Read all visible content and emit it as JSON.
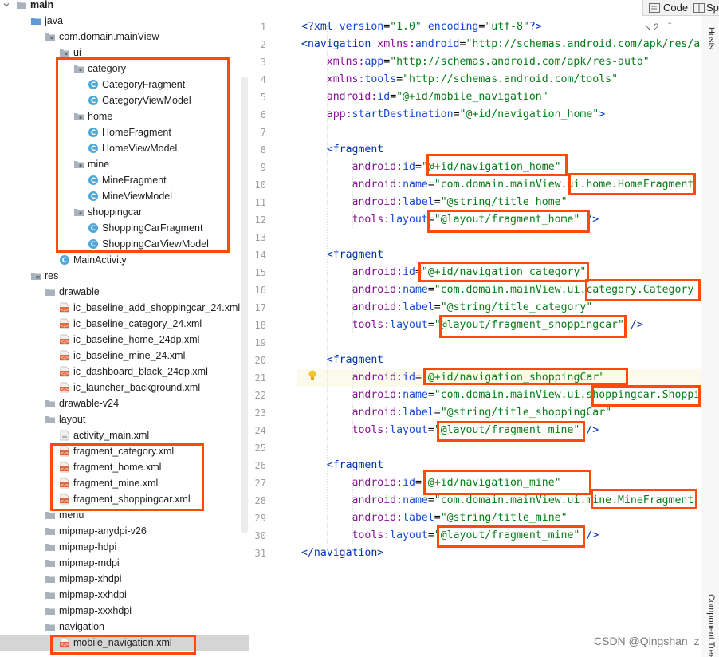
{
  "project_tree": {
    "rows": [
      {
        "label": "main",
        "icon": "folder-icon",
        "expanded": true,
        "bold": true
      },
      {
        "label": "java",
        "icon": "source-folder-icon",
        "expanded": true
      },
      {
        "label": "com.domain.mainView",
        "icon": "package-icon",
        "expanded": true
      },
      {
        "label": "ui",
        "icon": "package-icon",
        "expanded": true
      },
      {
        "label": "category",
        "icon": "package-icon",
        "expanded": true
      },
      {
        "label": "CategoryFragment",
        "icon": "kotlin-class-icon"
      },
      {
        "label": "CategoryViewModel",
        "icon": "kotlin-class-icon"
      },
      {
        "label": "home",
        "icon": "package-icon",
        "expanded": true
      },
      {
        "label": "HomeFragment",
        "icon": "kotlin-class-icon"
      },
      {
        "label": "HomeViewModel",
        "icon": "kotlin-class-icon"
      },
      {
        "label": "mine",
        "icon": "package-icon",
        "expanded": true
      },
      {
        "label": "MineFragment",
        "icon": "kotlin-class-icon"
      },
      {
        "label": "MineViewModel",
        "icon": "kotlin-class-icon"
      },
      {
        "label": "shoppingcar",
        "icon": "package-icon",
        "expanded": true
      },
      {
        "label": "ShoppingCarFragment",
        "icon": "kotlin-class-icon"
      },
      {
        "label": "ShoppingCarViewModel",
        "icon": "kotlin-class-icon"
      },
      {
        "label": "MainActivity",
        "icon": "kotlin-class-icon"
      },
      {
        "label": "res",
        "icon": "resource-folder-icon",
        "expanded": true
      },
      {
        "label": "drawable",
        "icon": "folder-icon",
        "expanded": true
      },
      {
        "label": "ic_baseline_add_shoppingcar_24.xml",
        "icon": "xml-file-icon"
      },
      {
        "label": "ic_baseline_category_24.xml",
        "icon": "xml-file-icon"
      },
      {
        "label": "ic_baseline_home_24dp.xml",
        "icon": "xml-file-icon"
      },
      {
        "label": "ic_baseline_mine_24.xml",
        "icon": "xml-file-icon"
      },
      {
        "label": "ic_dashboard_black_24dp.xml",
        "icon": "xml-file-icon"
      },
      {
        "label": "ic_launcher_background.xml",
        "icon": "xml-file-icon"
      },
      {
        "label": "drawable-v24",
        "icon": "folder-icon",
        "expanded": false
      },
      {
        "label": "layout",
        "icon": "folder-icon",
        "expanded": true
      },
      {
        "label": "activity_main.xml",
        "icon": "layout-file-icon"
      },
      {
        "label": "fragment_category.xml",
        "icon": "xml-file-icon"
      },
      {
        "label": "fragment_home.xml",
        "icon": "xml-file-icon"
      },
      {
        "label": "fragment_mine.xml",
        "icon": "xml-file-icon"
      },
      {
        "label": "fragment_shoppingcar.xml",
        "icon": "xml-file-icon"
      },
      {
        "label": "menu",
        "icon": "folder-icon",
        "expanded": false
      },
      {
        "label": "mipmap-anydpi-v26",
        "icon": "folder-icon",
        "expanded": false
      },
      {
        "label": "mipmap-hdpi",
        "icon": "folder-icon",
        "expanded": false
      },
      {
        "label": "mipmap-mdpi",
        "icon": "folder-icon",
        "expanded": false
      },
      {
        "label": "mipmap-xhdpi",
        "icon": "folder-icon",
        "expanded": false
      },
      {
        "label": "mipmap-xxhdpi",
        "icon": "folder-icon",
        "expanded": false
      },
      {
        "label": "mipmap-xxxhdpi",
        "icon": "folder-icon",
        "expanded": false
      },
      {
        "label": "navigation",
        "icon": "folder-icon",
        "expanded": true
      },
      {
        "label": "mobile_navigation.xml",
        "icon": "xml-file-icon",
        "selected": true
      }
    ]
  },
  "editor": {
    "view_tabs": {
      "code": "Code",
      "split": "Spl"
    },
    "inspection_count": "2",
    "right_rail": {
      "hosts": "Hosts",
      "component_tree": "Component Tree"
    },
    "lines": [
      [
        [
          "pi",
          "<?xml "
        ],
        [
          "attr",
          "version"
        ],
        [
          "punc",
          "="
        ],
        [
          "val",
          "\"1.0\""
        ],
        [
          "punc",
          " "
        ],
        [
          "attr",
          "encoding"
        ],
        [
          "punc",
          "="
        ],
        [
          "val",
          "\"utf-8\""
        ],
        [
          "pi",
          "?>"
        ]
      ],
      [
        [
          "tag",
          "<navigation "
        ],
        [
          "ns",
          "xmlns:"
        ],
        [
          "attr",
          "android"
        ],
        [
          "punc",
          "="
        ],
        [
          "val",
          "\"http://schemas.android.com/apk/res/a"
        ]
      ],
      [
        [
          "punc",
          "    "
        ],
        [
          "ns",
          "xmlns:"
        ],
        [
          "attr",
          "app"
        ],
        [
          "punc",
          "="
        ],
        [
          "val",
          "\"http://schemas.android.com/apk/res-auto\""
        ]
      ],
      [
        [
          "punc",
          "    "
        ],
        [
          "ns",
          "xmlns:"
        ],
        [
          "attr",
          "tools"
        ],
        [
          "punc",
          "="
        ],
        [
          "val",
          "\"http://schemas.android.com/tools\""
        ]
      ],
      [
        [
          "punc",
          "    "
        ],
        [
          "ns",
          "android:"
        ],
        [
          "attr",
          "id"
        ],
        [
          "punc",
          "="
        ],
        [
          "val",
          "\"@+id/mobile_navigation\""
        ]
      ],
      [
        [
          "punc",
          "    "
        ],
        [
          "ns",
          "app:"
        ],
        [
          "attr",
          "startDestination"
        ],
        [
          "punc",
          "="
        ],
        [
          "val",
          "\"@+id/navigation_home\""
        ],
        [
          "tag",
          ">"
        ]
      ],
      [
        [
          "punc",
          ""
        ]
      ],
      [
        [
          "punc",
          "    "
        ],
        [
          "tag",
          "<fragment"
        ]
      ],
      [
        [
          "punc",
          "        "
        ],
        [
          "ns",
          "android:"
        ],
        [
          "attr",
          "id"
        ],
        [
          "punc",
          "="
        ],
        [
          "val",
          "\"@+id/navigation_home\""
        ]
      ],
      [
        [
          "punc",
          "        "
        ],
        [
          "ns",
          "android:"
        ],
        [
          "attr",
          "name"
        ],
        [
          "punc",
          "="
        ],
        [
          "val",
          "\"com.domain.mainView.ui.home.HomeFragment"
        ]
      ],
      [
        [
          "punc",
          "        "
        ],
        [
          "ns",
          "android:"
        ],
        [
          "attr",
          "label"
        ],
        [
          "punc",
          "="
        ],
        [
          "val",
          "\"@string/title_home\""
        ]
      ],
      [
        [
          "punc",
          "        "
        ],
        [
          "ns",
          "tools:"
        ],
        [
          "attr",
          "layout"
        ],
        [
          "punc",
          "="
        ],
        [
          "val",
          "\"@layout/fragment_home\""
        ],
        [
          "tag",
          " />"
        ]
      ],
      [
        [
          "punc",
          ""
        ]
      ],
      [
        [
          "punc",
          "    "
        ],
        [
          "tag",
          "<fragment"
        ]
      ],
      [
        [
          "punc",
          "        "
        ],
        [
          "ns",
          "android:"
        ],
        [
          "attr",
          "id"
        ],
        [
          "punc",
          "="
        ],
        [
          "val",
          "\"@+id/navigation_category\""
        ]
      ],
      [
        [
          "punc",
          "        "
        ],
        [
          "ns",
          "android:"
        ],
        [
          "attr",
          "name"
        ],
        [
          "punc",
          "="
        ],
        [
          "val",
          "\"com.domain.mainView.ui.category.Category"
        ]
      ],
      [
        [
          "punc",
          "        "
        ],
        [
          "ns",
          "android:"
        ],
        [
          "attr",
          "label"
        ],
        [
          "punc",
          "="
        ],
        [
          "val",
          "\"@string/title_category\""
        ]
      ],
      [
        [
          "punc",
          "        "
        ],
        [
          "ns",
          "tools:"
        ],
        [
          "attr",
          "layout"
        ],
        [
          "punc",
          "="
        ],
        [
          "val",
          "\"@layout/fragment_shoppingcar\""
        ],
        [
          "tag",
          " />"
        ]
      ],
      [
        [
          "punc",
          ""
        ]
      ],
      [
        [
          "punc",
          "    "
        ],
        [
          "tag",
          "<fragment"
        ]
      ],
      [
        [
          "punc",
          "        "
        ],
        [
          "ns",
          "android:"
        ],
        [
          "attr",
          "id"
        ],
        [
          "punc",
          "="
        ],
        [
          "val",
          "\"@+id/navigation_shoppingCar\""
        ]
      ],
      [
        [
          "punc",
          "        "
        ],
        [
          "ns",
          "android:"
        ],
        [
          "attr",
          "name"
        ],
        [
          "punc",
          "="
        ],
        [
          "val",
          "\"com.domain.mainView.ui.shoppingcar.Shoppi"
        ]
      ],
      [
        [
          "punc",
          "        "
        ],
        [
          "ns",
          "android:"
        ],
        [
          "attr",
          "label"
        ],
        [
          "punc",
          "="
        ],
        [
          "val",
          "\"@string/title_shoppingCar\""
        ]
      ],
      [
        [
          "punc",
          "        "
        ],
        [
          "ns",
          "tools:"
        ],
        [
          "attr",
          "layout"
        ],
        [
          "punc",
          "="
        ],
        [
          "val",
          "\"@layout/fragment_mine\""
        ],
        [
          "tag",
          " />"
        ]
      ],
      [
        [
          "punc",
          ""
        ]
      ],
      [
        [
          "punc",
          "    "
        ],
        [
          "tag",
          "<fragment"
        ]
      ],
      [
        [
          "punc",
          "        "
        ],
        [
          "ns",
          "android:"
        ],
        [
          "attr",
          "id"
        ],
        [
          "punc",
          "="
        ],
        [
          "val",
          "\"@+id/navigation_mine\""
        ]
      ],
      [
        [
          "punc",
          "        "
        ],
        [
          "ns",
          "android:"
        ],
        [
          "attr",
          "name"
        ],
        [
          "punc",
          "="
        ],
        [
          "val",
          "\"com.domain.mainView.ui.mine.MineFragment"
        ]
      ],
      [
        [
          "punc",
          "        "
        ],
        [
          "ns",
          "android:"
        ],
        [
          "attr",
          "label"
        ],
        [
          "punc",
          "="
        ],
        [
          "val",
          "\"@string/title_mine\""
        ]
      ],
      [
        [
          "punc",
          "        "
        ],
        [
          "ns",
          "tools:"
        ],
        [
          "attr",
          "layout"
        ],
        [
          "punc",
          "="
        ],
        [
          "val",
          "\"@layout/fragment_mine\""
        ],
        [
          "tag",
          " />"
        ]
      ],
      [
        [
          "tag",
          "</navigation>"
        ]
      ]
    ],
    "current_line": 21
  },
  "watermark": "CSDN @Qingshan_z",
  "colors": {
    "highlight": "#ff4a0b",
    "selection": "#d5d5d5",
    "current_line": "#fcfaed"
  }
}
